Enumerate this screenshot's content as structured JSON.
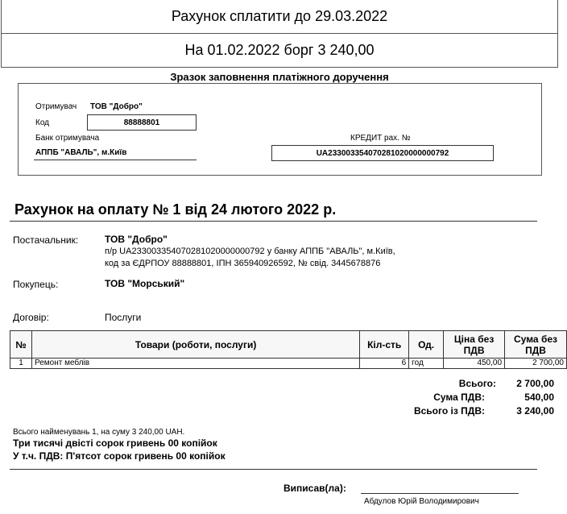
{
  "header": {
    "due_line": "Рахунок сплатити до 29.03.2022",
    "debt_line": "На 01.02.2022 борг 3 240,00"
  },
  "sample": {
    "title": "Зразок заповнення платіжного доручення",
    "recipient_label": "Отримувач",
    "recipient_value": "ТОВ \"Добро\"",
    "code_label": "Код",
    "code_value": "88888801",
    "bank_label": "Банк отримувача",
    "bank_value": "АППБ \"АВАЛЬ\", м.Київ",
    "credit_label": "КРЕДИТ рах. №",
    "credit_value": "UA233003354070281020000000792"
  },
  "invoice": {
    "title": "Рахунок на оплату № 1 від 24 лютого 2022 р."
  },
  "parties": {
    "supplier_label": "Постачальник:",
    "supplier_name": "ТОВ \"Добро\"",
    "supplier_details_1": "п/р UA233003354070281020000000792 у банку АППБ \"АВАЛЬ\", м.Київ,",
    "supplier_details_2": "код за ЄДРПОУ 88888801, ІПН 365940926592, № свід. 3445678876",
    "buyer_label": "Покупець:",
    "buyer_name": "ТОВ \"Морський\"",
    "contract_label": "Договір:",
    "contract_value": "Послуги"
  },
  "table": {
    "headers": {
      "num": "№",
      "goods": "Товари (роботи, послуги)",
      "qty": "Кіл-сть",
      "unit": "Од.",
      "price": "Ціна без ПДВ",
      "sum": "Сума без ПДВ"
    },
    "rows": [
      {
        "num": "1",
        "goods": "Ремонт меблів",
        "qty": "6",
        "unit": "год",
        "price": "450,00",
        "sum": "2 700,00"
      }
    ]
  },
  "totals": {
    "total_label": "Всього:",
    "total_value": "2 700,00",
    "vat_label": "Сума ПДВ:",
    "vat_value": "540,00",
    "grand_label": "Всього із ПДВ:",
    "grand_value": "3 240,00"
  },
  "summary": {
    "count_line": "Всього найменувань 1, на суму 3 240,00 UAH.",
    "words_total": "Три тисячі двісті сорок гривень 00 копійок",
    "words_vat": "У т.ч. ПДВ: П'ятсот сорок гривень 00 копійок"
  },
  "signature": {
    "label": "Виписав(ла):",
    "name": "Абдулов Юрій Володимирович"
  }
}
